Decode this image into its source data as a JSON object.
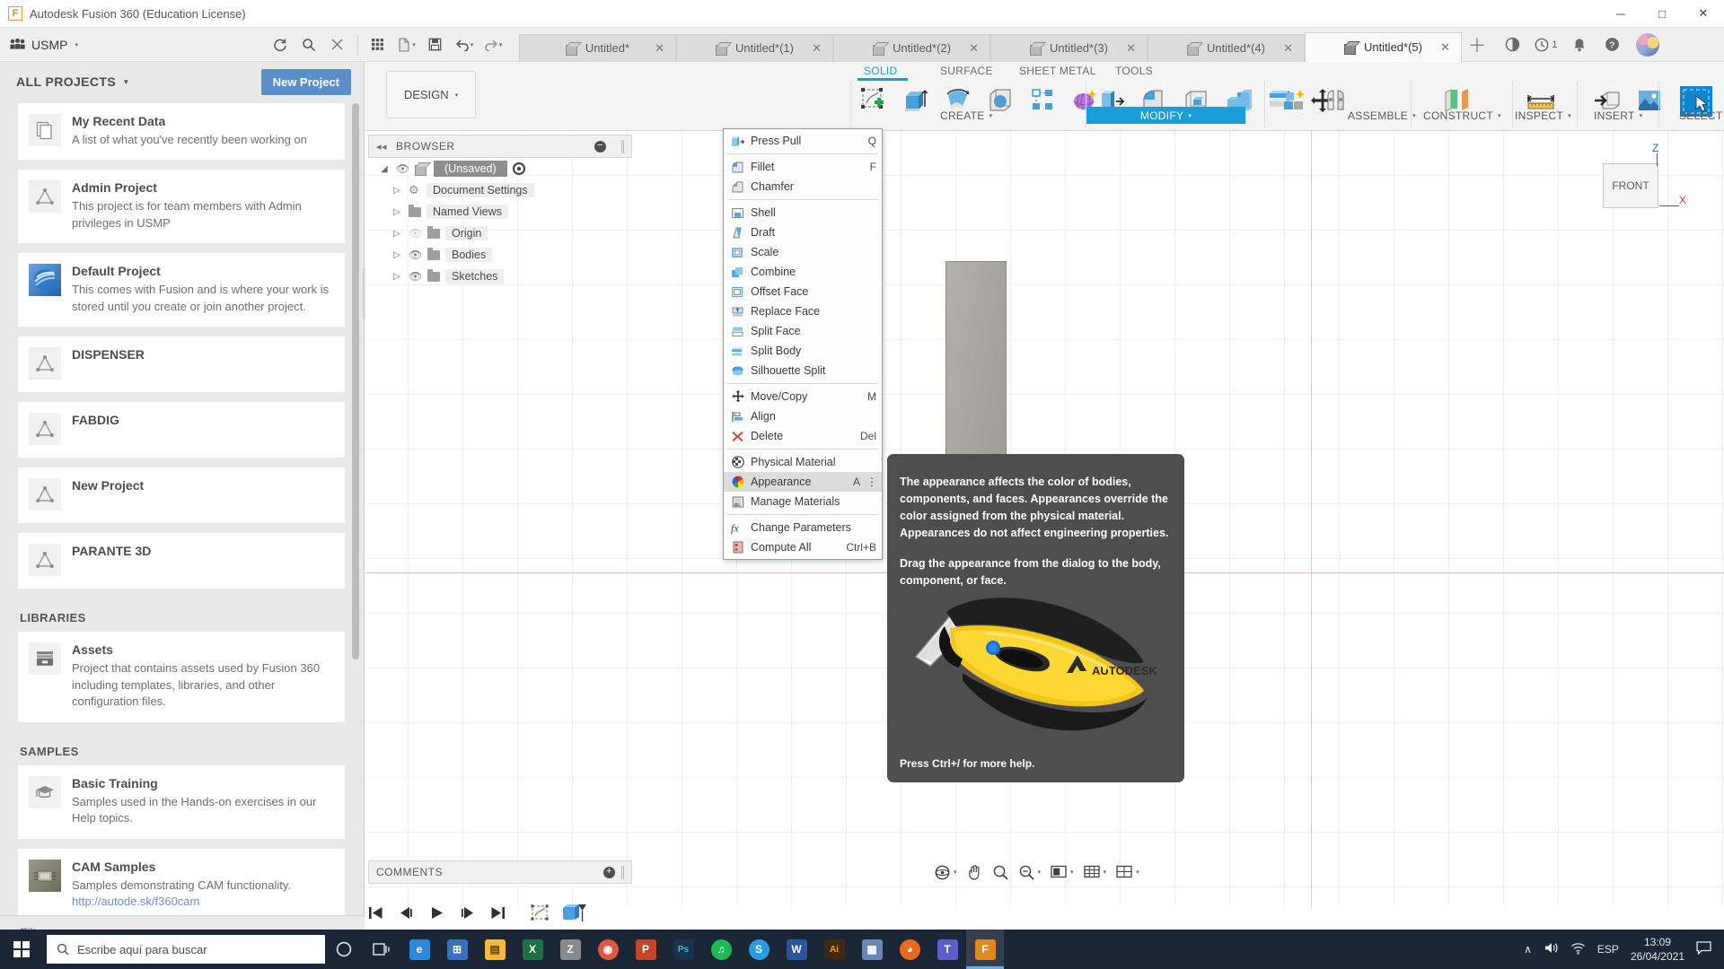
{
  "titlebar": {
    "app_icon": "fusion-logo-icon",
    "title": "Autodesk Fusion 360 (Education License)",
    "minimize": "─",
    "maximize": "□",
    "close": "✕"
  },
  "topbar": {
    "hub_icon": "people-icon",
    "hub_name": "USMP",
    "hub_chevron": "▾",
    "quick_access": [
      {
        "name": "refresh-icon",
        "glyph": "⟳"
      },
      {
        "name": "search-icon",
        "glyph": "⌕"
      },
      {
        "name": "close-panel-icon",
        "glyph": "✕"
      },
      {
        "name": "grid-icon",
        "glyph": "☷"
      },
      {
        "name": "new-file-icon",
        "glyph": "⬚"
      },
      {
        "name": "save-icon",
        "glyph": "Ὃe"
      },
      {
        "name": "undo-icon",
        "glyph": "↶"
      },
      {
        "name": "redo-icon",
        "glyph": "↷"
      }
    ],
    "tabs": [
      {
        "label": "Untitled*",
        "active": false
      },
      {
        "label": "Untitled*(1)",
        "active": false
      },
      {
        "label": "Untitled*(2)",
        "active": false
      },
      {
        "label": "Untitled*(3)",
        "active": false
      },
      {
        "label": "Untitled*(4)",
        "active": false
      },
      {
        "label": "Untitled*(5)",
        "active": true
      }
    ],
    "tab_close_glyph": "✕",
    "new_tab_glyph": "＋",
    "right_icons": [
      {
        "name": "extension-manager-icon",
        "glyph": "◔"
      },
      {
        "name": "job-status-icon",
        "glyph": "◴",
        "badge": "1"
      },
      {
        "name": "notifications-bell-icon",
        "glyph": "🔔"
      },
      {
        "name": "help-icon",
        "glyph": "?"
      }
    ],
    "avatar": "user-avatar"
  },
  "data_panel": {
    "title": "ALL PROJECTS",
    "chevron": "▾",
    "new_project_label": "New Project",
    "filter_placeholder": "Filter",
    "sections": [
      {
        "label": "",
        "cards": [
          {
            "icon": "documents-icon",
            "name": "My Recent Data",
            "desc": "A list of what you've recently been working on"
          },
          {
            "icon": "project-triangle-icon",
            "name": "Admin Project",
            "desc": "This project is for team members with Admin privileges in USMP"
          },
          {
            "icon": "fusion-sphere-icon",
            "name": "Default Project",
            "desc": "This comes with Fusion and is where your work is stored until you create or join another project."
          },
          {
            "icon": "project-triangle-icon",
            "name": "DISPENSER",
            "desc": ""
          },
          {
            "icon": "project-triangle-icon",
            "name": "FABDIG",
            "desc": ""
          },
          {
            "icon": "project-triangle-icon",
            "name": "New Project",
            "desc": ""
          },
          {
            "icon": "project-triangle-icon",
            "name": "PARANTE 3D",
            "desc": ""
          }
        ]
      },
      {
        "label": "LIBRARIES",
        "cards": [
          {
            "icon": "assets-box-icon",
            "name": "Assets",
            "desc": "Project that contains assets used by Fusion 360 including templates, libraries, and other configuration files."
          }
        ]
      },
      {
        "label": "SAMPLES",
        "cards": [
          {
            "icon": "graduation-cap-icon",
            "name": "Basic Training",
            "desc": "Samples used in the Hands-on exercises in our Help topics."
          },
          {
            "icon": "cam-chip-icon",
            "name": "CAM Samples",
            "desc": "Samples demonstrating CAM functionality.",
            "link": "http://autode.sk/f360cam"
          }
        ]
      }
    ]
  },
  "ribbon": {
    "workspace_label": "DESIGN",
    "workspace_caret": "▾",
    "tabs": [
      {
        "label": "SOLID",
        "active": true
      },
      {
        "label": "SURFACE",
        "active": false
      },
      {
        "label": "SHEET METAL",
        "active": false
      },
      {
        "label": "TOOLS",
        "active": false
      }
    ],
    "panels": [
      {
        "label": "CREATE",
        "caret": "▾",
        "highlighted": false,
        "icons": [
          "create-sketch-icon",
          "extrude-icon",
          "revolve-icon",
          "sweep-icon",
          "pattern-icon",
          "form-icon"
        ]
      },
      {
        "label": "MODIFY",
        "caret": "▾",
        "highlighted": true,
        "icons": [
          "press-pull-icon",
          "fillet-icon",
          "shell-icon",
          "combine-icon",
          "split-body-icon",
          "move-copy-icon"
        ]
      },
      {
        "label": "ASSEMBLE",
        "caret": "▾",
        "highlighted": false,
        "icons": [
          "new-component-icon",
          "joint-icon"
        ]
      },
      {
        "label": "CONSTRUCT",
        "caret": "▾",
        "highlighted": false,
        "icons": [
          "offset-plane-icon"
        ]
      },
      {
        "label": "INSPECT",
        "caret": "▾",
        "highlighted": false,
        "icons": [
          "measure-icon"
        ]
      },
      {
        "label": "INSERT",
        "caret": "▾",
        "highlighted": false,
        "icons": [
          "insert-derive-icon",
          "insert-image-icon"
        ]
      },
      {
        "label": "SELECT",
        "caret": "▾",
        "highlighted": false,
        "icons": [
          "select-window-icon"
        ]
      }
    ]
  },
  "modify_menu": {
    "items": [
      {
        "icon": "press-pull-icon",
        "label": "Press Pull",
        "shortcut": "Q",
        "selected": false,
        "divider_after": true
      },
      {
        "icon": "fillet-icon",
        "label": "Fillet",
        "shortcut": "F",
        "selected": false
      },
      {
        "icon": "chamfer-icon",
        "label": "Chamfer",
        "shortcut": "",
        "selected": false,
        "divider_after": true
      },
      {
        "icon": "shell-icon",
        "label": "Shell",
        "shortcut": "",
        "selected": false
      },
      {
        "icon": "draft-icon",
        "label": "Draft",
        "shortcut": "",
        "selected": false
      },
      {
        "icon": "scale-icon",
        "label": "Scale",
        "shortcut": "",
        "selected": false
      },
      {
        "icon": "combine-icon",
        "label": "Combine",
        "shortcut": "",
        "selected": false
      },
      {
        "icon": "offset-face-icon",
        "label": "Offset Face",
        "shortcut": "",
        "selected": false
      },
      {
        "icon": "replace-face-icon",
        "label": "Replace Face",
        "shortcut": "",
        "selected": false
      },
      {
        "icon": "split-face-icon",
        "label": "Split Face",
        "shortcut": "",
        "selected": false
      },
      {
        "icon": "split-body-icon",
        "label": "Split Body",
        "shortcut": "",
        "selected": false
      },
      {
        "icon": "silhouette-split-icon",
        "label": "Silhouette Split",
        "shortcut": "",
        "selected": false,
        "divider_after": true
      },
      {
        "icon": "move-copy-icon",
        "label": "Move/Copy",
        "shortcut": "M",
        "selected": false
      },
      {
        "icon": "align-icon",
        "label": "Align",
        "shortcut": "",
        "selected": false
      },
      {
        "icon": "delete-icon",
        "label": "Delete",
        "shortcut": "Del",
        "selected": false,
        "divider_after": true
      },
      {
        "icon": "physical-material-icon",
        "label": "Physical Material",
        "shortcut": "",
        "selected": false
      },
      {
        "icon": "appearance-icon",
        "label": "Appearance",
        "shortcut": "A",
        "selected": true,
        "more": "⋮"
      },
      {
        "icon": "manage-materials-icon",
        "label": "Manage Materials",
        "shortcut": "",
        "selected": false,
        "divider_after": true
      },
      {
        "icon": "change-parameters-icon",
        "label": "Change Parameters",
        "shortcut": "",
        "selected": false
      },
      {
        "icon": "compute-all-icon",
        "label": "Compute All",
        "shortcut": "Ctrl+B",
        "selected": false
      }
    ]
  },
  "tooltip": {
    "paragraph1": "The appearance affects the color of bodies, components, and faces. Appearances override the color assigned from the physical material. Appearances do not affect engineering properties.",
    "paragraph2": "Drag the appearance from the dialog to the body, component, or face.",
    "image": "autodesk-utility-knife-image",
    "footer": "Press Ctrl+/ for more help.",
    "bg_color": "#4e4e4e"
  },
  "browser": {
    "header": "BROWSER",
    "collapse_glyph": "◂◂",
    "minus_glyph": "−",
    "nodes": [
      {
        "label": "(Unsaved)",
        "icon": "component-cube-icon",
        "eye": "visible",
        "root": true
      },
      {
        "label": "Document Settings",
        "icon": "gear-icon",
        "eye": "none"
      },
      {
        "label": "Named Views",
        "icon": "folder-icon",
        "eye": "none"
      },
      {
        "label": "Origin",
        "icon": "folder-icon",
        "eye": "hidden"
      },
      {
        "label": "Bodies",
        "icon": "folder-icon",
        "eye": "visible"
      },
      {
        "label": "Sketches",
        "icon": "folder-icon",
        "eye": "visible"
      }
    ]
  },
  "comments": {
    "label": "COMMENTS",
    "plus_glyph": "+"
  },
  "canvas": {
    "viewcube_face": "FRONT",
    "axis_z": "Z",
    "axis_x": "X",
    "nav_icons": [
      {
        "name": "orbit-icon",
        "glyph": "⊕",
        "caret": "▾"
      },
      {
        "name": "pan-icon",
        "glyph": "✋"
      },
      {
        "name": "zoom-icon",
        "glyph": "⌕"
      },
      {
        "name": "zoom-fit-icon",
        "glyph": "⌕",
        "caret": "▾"
      },
      {
        "name": "display-settings-icon",
        "glyph": "▣",
        "caret": "▾"
      },
      {
        "name": "grid-snaps-icon",
        "glyph": "▦",
        "caret": "▾"
      },
      {
        "name": "viewports-icon",
        "glyph": "▥",
        "caret": "▾"
      }
    ]
  },
  "timeline": {
    "buttons": [
      {
        "name": "timeline-begin-icon",
        "glyph": "⏮"
      },
      {
        "name": "timeline-step-back-icon",
        "glyph": "◀"
      },
      {
        "name": "timeline-play-icon",
        "glyph": "▶"
      },
      {
        "name": "timeline-step-forward-icon",
        "glyph": "▶"
      },
      {
        "name": "timeline-end-icon",
        "glyph": "⏭"
      }
    ],
    "features": [
      {
        "name": "sketch-feature-icon"
      },
      {
        "name": "extrude-feature-icon"
      }
    ]
  },
  "taskbar": {
    "start": "windows-start-icon",
    "search_placeholder": "Escribe aquí para buscar",
    "search_icon": "search-icon",
    "items": [
      {
        "name": "cortana-icon",
        "glyph": "○",
        "color": "transparent",
        "text": "#ffffff"
      },
      {
        "name": "task-view-icon",
        "glyph": "▣",
        "color": "transparent",
        "text": "#ffffff"
      },
      {
        "name": "edge-icon",
        "glyph": "e",
        "color": "#2d8ad9",
        "text": "#ffffff"
      },
      {
        "name": "store-icon",
        "glyph": "⊞",
        "color": "#3a6fbd",
        "text": "#ffffff"
      },
      {
        "name": "file-explorer-icon",
        "glyph": "🗀",
        "color": "#f6b93b",
        "text": "#5a4300"
      },
      {
        "name": "excel-icon",
        "glyph": "X",
        "color": "#1d7044",
        "text": "#ffffff"
      },
      {
        "name": "zbrush-icon",
        "glyph": "Z",
        "color": "#8a8a8a",
        "text": "#ffffff"
      },
      {
        "name": "chrome-icon",
        "glyph": "◉",
        "color": "#e0563f",
        "text": "#ffffff"
      },
      {
        "name": "powerpoint-icon",
        "glyph": "P",
        "color": "#c4462a",
        "text": "#ffffff"
      },
      {
        "name": "photoshop-icon",
        "glyph": "Ps",
        "color": "#17344c",
        "text": "#41b0e0"
      },
      {
        "name": "spotify-icon",
        "glyph": "♫",
        "color": "#1db954",
        "text": "#ffffff"
      },
      {
        "name": "skype-icon",
        "glyph": "S",
        "color": "#2a9de0",
        "text": "#ffffff"
      },
      {
        "name": "word-icon",
        "glyph": "W",
        "color": "#2a5699",
        "text": "#ffffff"
      },
      {
        "name": "illustrator-icon",
        "glyph": "Ai",
        "color": "#3d2a14",
        "text": "#ff9a00"
      },
      {
        "name": "app-icon",
        "glyph": "▦",
        "color": "#6a86b5",
        "text": "#ffffff"
      },
      {
        "name": "firefox-icon",
        "glyph": "◕",
        "color": "#e86a1c",
        "text": "#ffffff"
      },
      {
        "name": "teams-icon",
        "glyph": "T",
        "color": "#5b5fc7",
        "text": "#ffffff"
      },
      {
        "name": "fusion360-icon",
        "glyph": "F",
        "color": "#e08a1e",
        "text": "#ffffff",
        "active": true
      }
    ],
    "tray": {
      "chevron": "∧",
      "volume": "🔊",
      "network": "◡",
      "language": "ESP",
      "time": "13:09",
      "date": "26/04/2021",
      "action_center": "▢"
    }
  }
}
